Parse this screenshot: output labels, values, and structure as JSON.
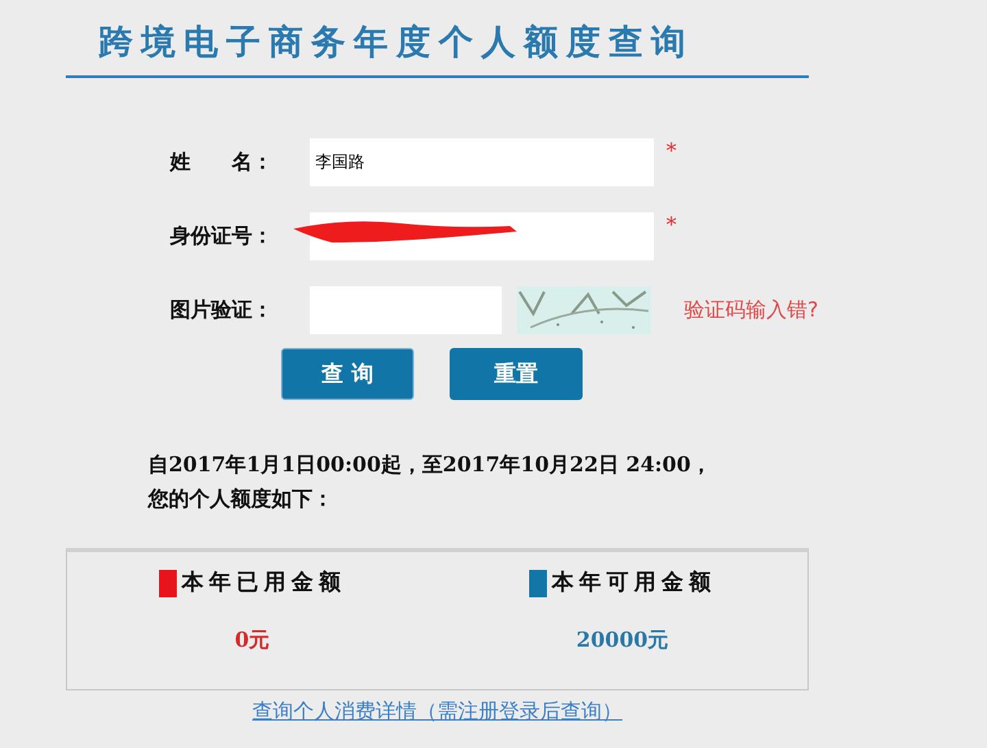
{
  "title": "跨境电子商务年度个人额度查询",
  "form": {
    "fields": [
      {
        "kind": "text",
        "label": "姓　　名：",
        "value": "李国路",
        "required": true,
        "redacted": false
      },
      {
        "kind": "text",
        "label": "身份证号：",
        "required": true,
        "redacted": true
      },
      {
        "kind": "captcha",
        "label": "图片验证：",
        "required": false,
        "redacted": false,
        "link": "验证码输入错?"
      }
    ],
    "required_mark": "*",
    "buttons": [
      "查 询",
      "重置"
    ]
  },
  "summary": [
    "自2017年1月1日00:00起，至2017年10月22日 24:00，",
    "您的个人额度如下："
  ],
  "quota": [
    {
      "label": "本年已用金额",
      "color": "#e8141b",
      "amount": "0元"
    },
    {
      "label": "本年可用金额",
      "color": "#1276a6",
      "amount": "20000元"
    }
  ],
  "details_link": "查询个人消费详情（需注册登录后查询）"
}
